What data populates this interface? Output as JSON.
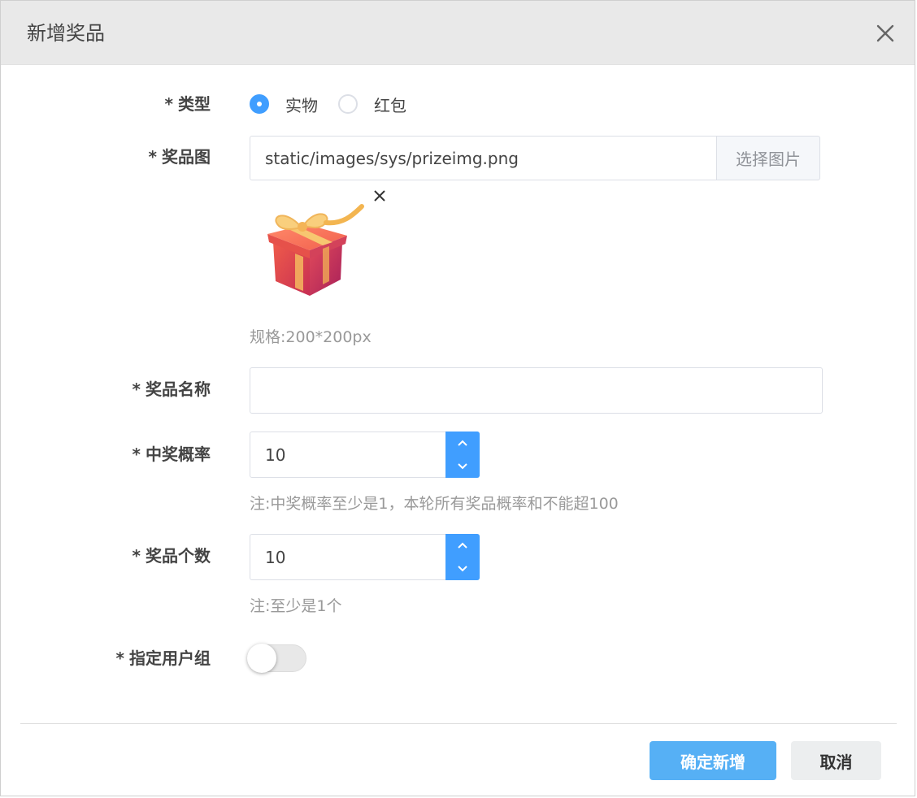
{
  "dialog": {
    "title": "新增奖品"
  },
  "form": {
    "type": {
      "label": "类型",
      "required_mark": "*",
      "options": [
        {
          "label": "实物",
          "checked": true
        },
        {
          "label": "红包",
          "checked": false
        }
      ]
    },
    "prize_image": {
      "label": "奖品图",
      "required_mark": "*",
      "value": "static/images/sys/prizeimg.png",
      "button_label": "选择图片",
      "preview_icon": "gift-box-icon",
      "hint": "规格:200*200px"
    },
    "prize_name": {
      "label": "奖品名称",
      "required_mark": "*",
      "value": ""
    },
    "win_rate": {
      "label": "中奖概率",
      "required_mark": "*",
      "value": "10",
      "hint": "注:中奖概率至少是1，本轮所有奖品概率和不能超100"
    },
    "prize_count": {
      "label": "奖品个数",
      "required_mark": "*",
      "value": "10",
      "hint": "注:至少是1个"
    },
    "user_group": {
      "label": "指定用户组",
      "required_mark": "*",
      "enabled": false
    }
  },
  "footer": {
    "confirm_label": "确定新增",
    "cancel_label": "取消"
  },
  "colors": {
    "accent": "#409eff",
    "primary_button": "#56b0f5",
    "header_bg": "#e9e9e9"
  }
}
